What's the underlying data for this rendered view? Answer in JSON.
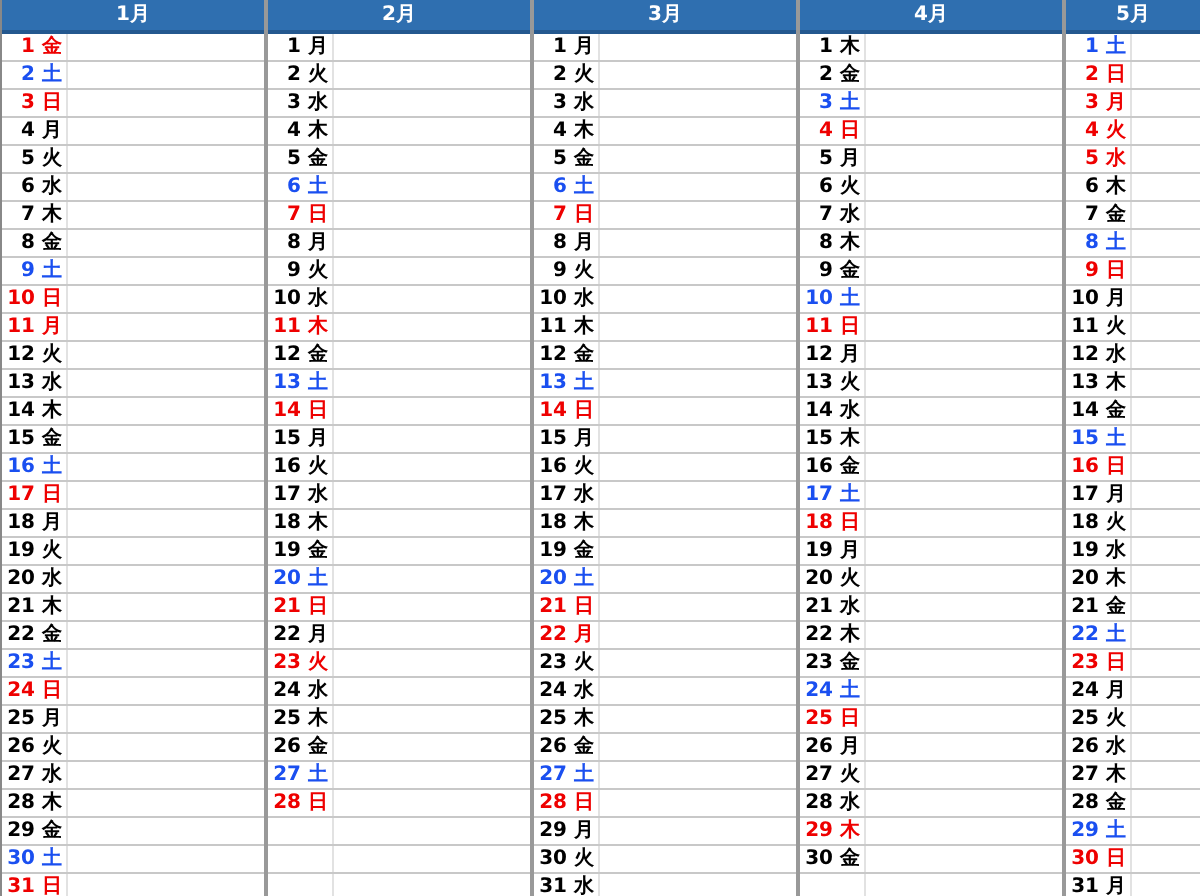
{
  "months": [
    {
      "label": "1月",
      "days": [
        {
          "day": "1",
          "weekday": "金",
          "kind": "holiday"
        },
        {
          "day": "2",
          "weekday": "土",
          "kind": "saturday"
        },
        {
          "day": "3",
          "weekday": "日",
          "kind": "holiday"
        },
        {
          "day": "4",
          "weekday": "月",
          "kind": "weekday"
        },
        {
          "day": "5",
          "weekday": "火",
          "kind": "weekday"
        },
        {
          "day": "6",
          "weekday": "水",
          "kind": "weekday"
        },
        {
          "day": "7",
          "weekday": "木",
          "kind": "weekday"
        },
        {
          "day": "8",
          "weekday": "金",
          "kind": "weekday"
        },
        {
          "day": "9",
          "weekday": "土",
          "kind": "saturday"
        },
        {
          "day": "10",
          "weekday": "日",
          "kind": "holiday"
        },
        {
          "day": "11",
          "weekday": "月",
          "kind": "holiday"
        },
        {
          "day": "12",
          "weekday": "火",
          "kind": "weekday"
        },
        {
          "day": "13",
          "weekday": "水",
          "kind": "weekday"
        },
        {
          "day": "14",
          "weekday": "木",
          "kind": "weekday"
        },
        {
          "day": "15",
          "weekday": "金",
          "kind": "weekday"
        },
        {
          "day": "16",
          "weekday": "土",
          "kind": "saturday"
        },
        {
          "day": "17",
          "weekday": "日",
          "kind": "holiday"
        },
        {
          "day": "18",
          "weekday": "月",
          "kind": "weekday"
        },
        {
          "day": "19",
          "weekday": "火",
          "kind": "weekday"
        },
        {
          "day": "20",
          "weekday": "水",
          "kind": "weekday"
        },
        {
          "day": "21",
          "weekday": "木",
          "kind": "weekday"
        },
        {
          "day": "22",
          "weekday": "金",
          "kind": "weekday"
        },
        {
          "day": "23",
          "weekday": "土",
          "kind": "saturday"
        },
        {
          "day": "24",
          "weekday": "日",
          "kind": "holiday"
        },
        {
          "day": "25",
          "weekday": "月",
          "kind": "weekday"
        },
        {
          "day": "26",
          "weekday": "火",
          "kind": "weekday"
        },
        {
          "day": "27",
          "weekday": "水",
          "kind": "weekday"
        },
        {
          "day": "28",
          "weekday": "木",
          "kind": "weekday"
        },
        {
          "day": "29",
          "weekday": "金",
          "kind": "weekday"
        },
        {
          "day": "30",
          "weekday": "土",
          "kind": "saturday"
        },
        {
          "day": "31",
          "weekday": "日",
          "kind": "holiday"
        }
      ]
    },
    {
      "label": "2月",
      "days": [
        {
          "day": "1",
          "weekday": "月",
          "kind": "weekday"
        },
        {
          "day": "2",
          "weekday": "火",
          "kind": "weekday"
        },
        {
          "day": "3",
          "weekday": "水",
          "kind": "weekday"
        },
        {
          "day": "4",
          "weekday": "木",
          "kind": "weekday"
        },
        {
          "day": "5",
          "weekday": "金",
          "kind": "weekday"
        },
        {
          "day": "6",
          "weekday": "土",
          "kind": "saturday"
        },
        {
          "day": "7",
          "weekday": "日",
          "kind": "holiday"
        },
        {
          "day": "8",
          "weekday": "月",
          "kind": "weekday"
        },
        {
          "day": "9",
          "weekday": "火",
          "kind": "weekday"
        },
        {
          "day": "10",
          "weekday": "水",
          "kind": "weekday"
        },
        {
          "day": "11",
          "weekday": "木",
          "kind": "holiday"
        },
        {
          "day": "12",
          "weekday": "金",
          "kind": "weekday"
        },
        {
          "day": "13",
          "weekday": "土",
          "kind": "saturday"
        },
        {
          "day": "14",
          "weekday": "日",
          "kind": "holiday"
        },
        {
          "day": "15",
          "weekday": "月",
          "kind": "weekday"
        },
        {
          "day": "16",
          "weekday": "火",
          "kind": "weekday"
        },
        {
          "day": "17",
          "weekday": "水",
          "kind": "weekday"
        },
        {
          "day": "18",
          "weekday": "木",
          "kind": "weekday"
        },
        {
          "day": "19",
          "weekday": "金",
          "kind": "weekday"
        },
        {
          "day": "20",
          "weekday": "土",
          "kind": "saturday"
        },
        {
          "day": "21",
          "weekday": "日",
          "kind": "holiday"
        },
        {
          "day": "22",
          "weekday": "月",
          "kind": "weekday"
        },
        {
          "day": "23",
          "weekday": "火",
          "kind": "holiday"
        },
        {
          "day": "24",
          "weekday": "水",
          "kind": "weekday"
        },
        {
          "day": "25",
          "weekday": "木",
          "kind": "weekday"
        },
        {
          "day": "26",
          "weekday": "金",
          "kind": "weekday"
        },
        {
          "day": "27",
          "weekday": "土",
          "kind": "saturday"
        },
        {
          "day": "28",
          "weekday": "日",
          "kind": "holiday"
        }
      ]
    },
    {
      "label": "3月",
      "days": [
        {
          "day": "1",
          "weekday": "月",
          "kind": "weekday"
        },
        {
          "day": "2",
          "weekday": "火",
          "kind": "weekday"
        },
        {
          "day": "3",
          "weekday": "水",
          "kind": "weekday"
        },
        {
          "day": "4",
          "weekday": "木",
          "kind": "weekday"
        },
        {
          "day": "5",
          "weekday": "金",
          "kind": "weekday"
        },
        {
          "day": "6",
          "weekday": "土",
          "kind": "saturday"
        },
        {
          "day": "7",
          "weekday": "日",
          "kind": "holiday"
        },
        {
          "day": "8",
          "weekday": "月",
          "kind": "weekday"
        },
        {
          "day": "9",
          "weekday": "火",
          "kind": "weekday"
        },
        {
          "day": "10",
          "weekday": "水",
          "kind": "weekday"
        },
        {
          "day": "11",
          "weekday": "木",
          "kind": "weekday"
        },
        {
          "day": "12",
          "weekday": "金",
          "kind": "weekday"
        },
        {
          "day": "13",
          "weekday": "土",
          "kind": "saturday"
        },
        {
          "day": "14",
          "weekday": "日",
          "kind": "holiday"
        },
        {
          "day": "15",
          "weekday": "月",
          "kind": "weekday"
        },
        {
          "day": "16",
          "weekday": "火",
          "kind": "weekday"
        },
        {
          "day": "17",
          "weekday": "水",
          "kind": "weekday"
        },
        {
          "day": "18",
          "weekday": "木",
          "kind": "weekday"
        },
        {
          "day": "19",
          "weekday": "金",
          "kind": "weekday"
        },
        {
          "day": "20",
          "weekday": "土",
          "kind": "saturday"
        },
        {
          "day": "21",
          "weekday": "日",
          "kind": "holiday"
        },
        {
          "day": "22",
          "weekday": "月",
          "kind": "holiday"
        },
        {
          "day": "23",
          "weekday": "火",
          "kind": "weekday"
        },
        {
          "day": "24",
          "weekday": "水",
          "kind": "weekday"
        },
        {
          "day": "25",
          "weekday": "木",
          "kind": "weekday"
        },
        {
          "day": "26",
          "weekday": "金",
          "kind": "weekday"
        },
        {
          "day": "27",
          "weekday": "土",
          "kind": "saturday"
        },
        {
          "day": "28",
          "weekday": "日",
          "kind": "holiday"
        },
        {
          "day": "29",
          "weekday": "月",
          "kind": "weekday"
        },
        {
          "day": "30",
          "weekday": "火",
          "kind": "weekday"
        },
        {
          "day": "31",
          "weekday": "水",
          "kind": "weekday"
        }
      ]
    },
    {
      "label": "4月",
      "days": [
        {
          "day": "1",
          "weekday": "木",
          "kind": "weekday"
        },
        {
          "day": "2",
          "weekday": "金",
          "kind": "weekday"
        },
        {
          "day": "3",
          "weekday": "土",
          "kind": "saturday"
        },
        {
          "day": "4",
          "weekday": "日",
          "kind": "holiday"
        },
        {
          "day": "5",
          "weekday": "月",
          "kind": "weekday"
        },
        {
          "day": "6",
          "weekday": "火",
          "kind": "weekday"
        },
        {
          "day": "7",
          "weekday": "水",
          "kind": "weekday"
        },
        {
          "day": "8",
          "weekday": "木",
          "kind": "weekday"
        },
        {
          "day": "9",
          "weekday": "金",
          "kind": "weekday"
        },
        {
          "day": "10",
          "weekday": "土",
          "kind": "saturday"
        },
        {
          "day": "11",
          "weekday": "日",
          "kind": "holiday"
        },
        {
          "day": "12",
          "weekday": "月",
          "kind": "weekday"
        },
        {
          "day": "13",
          "weekday": "火",
          "kind": "weekday"
        },
        {
          "day": "14",
          "weekday": "水",
          "kind": "weekday"
        },
        {
          "day": "15",
          "weekday": "木",
          "kind": "weekday"
        },
        {
          "day": "16",
          "weekday": "金",
          "kind": "weekday"
        },
        {
          "day": "17",
          "weekday": "土",
          "kind": "saturday"
        },
        {
          "day": "18",
          "weekday": "日",
          "kind": "holiday"
        },
        {
          "day": "19",
          "weekday": "月",
          "kind": "weekday"
        },
        {
          "day": "20",
          "weekday": "火",
          "kind": "weekday"
        },
        {
          "day": "21",
          "weekday": "水",
          "kind": "weekday"
        },
        {
          "day": "22",
          "weekday": "木",
          "kind": "weekday"
        },
        {
          "day": "23",
          "weekday": "金",
          "kind": "weekday"
        },
        {
          "day": "24",
          "weekday": "土",
          "kind": "saturday"
        },
        {
          "day": "25",
          "weekday": "日",
          "kind": "holiday"
        },
        {
          "day": "26",
          "weekday": "月",
          "kind": "weekday"
        },
        {
          "day": "27",
          "weekday": "火",
          "kind": "weekday"
        },
        {
          "day": "28",
          "weekday": "水",
          "kind": "weekday"
        },
        {
          "day": "29",
          "weekday": "木",
          "kind": "holiday"
        },
        {
          "day": "30",
          "weekday": "金",
          "kind": "weekday"
        }
      ]
    },
    {
      "label": "5月",
      "days": [
        {
          "day": "1",
          "weekday": "土",
          "kind": "saturday"
        },
        {
          "day": "2",
          "weekday": "日",
          "kind": "holiday"
        },
        {
          "day": "3",
          "weekday": "月",
          "kind": "holiday"
        },
        {
          "day": "4",
          "weekday": "火",
          "kind": "holiday"
        },
        {
          "day": "5",
          "weekday": "水",
          "kind": "holiday"
        },
        {
          "day": "6",
          "weekday": "木",
          "kind": "weekday"
        },
        {
          "day": "7",
          "weekday": "金",
          "kind": "weekday"
        },
        {
          "day": "8",
          "weekday": "土",
          "kind": "saturday"
        },
        {
          "day": "9",
          "weekday": "日",
          "kind": "holiday"
        },
        {
          "day": "10",
          "weekday": "月",
          "kind": "weekday"
        },
        {
          "day": "11",
          "weekday": "火",
          "kind": "weekday"
        },
        {
          "day": "12",
          "weekday": "水",
          "kind": "weekday"
        },
        {
          "day": "13",
          "weekday": "木",
          "kind": "weekday"
        },
        {
          "day": "14",
          "weekday": "金",
          "kind": "weekday"
        },
        {
          "day": "15",
          "weekday": "土",
          "kind": "saturday"
        },
        {
          "day": "16",
          "weekday": "日",
          "kind": "holiday"
        },
        {
          "day": "17",
          "weekday": "月",
          "kind": "weekday"
        },
        {
          "day": "18",
          "weekday": "火",
          "kind": "weekday"
        },
        {
          "day": "19",
          "weekday": "水",
          "kind": "weekday"
        },
        {
          "day": "20",
          "weekday": "木",
          "kind": "weekday"
        },
        {
          "day": "21",
          "weekday": "金",
          "kind": "weekday"
        },
        {
          "day": "22",
          "weekday": "土",
          "kind": "saturday"
        },
        {
          "day": "23",
          "weekday": "日",
          "kind": "holiday"
        },
        {
          "day": "24",
          "weekday": "月",
          "kind": "weekday"
        },
        {
          "day": "25",
          "weekday": "火",
          "kind": "weekday"
        },
        {
          "day": "26",
          "weekday": "水",
          "kind": "weekday"
        },
        {
          "day": "27",
          "weekday": "木",
          "kind": "weekday"
        },
        {
          "day": "28",
          "weekday": "金",
          "kind": "weekday"
        },
        {
          "day": "29",
          "weekday": "土",
          "kind": "saturday"
        },
        {
          "day": "30",
          "weekday": "日",
          "kind": "holiday"
        },
        {
          "day": "31",
          "weekday": "月",
          "kind": "weekday"
        }
      ]
    }
  ]
}
